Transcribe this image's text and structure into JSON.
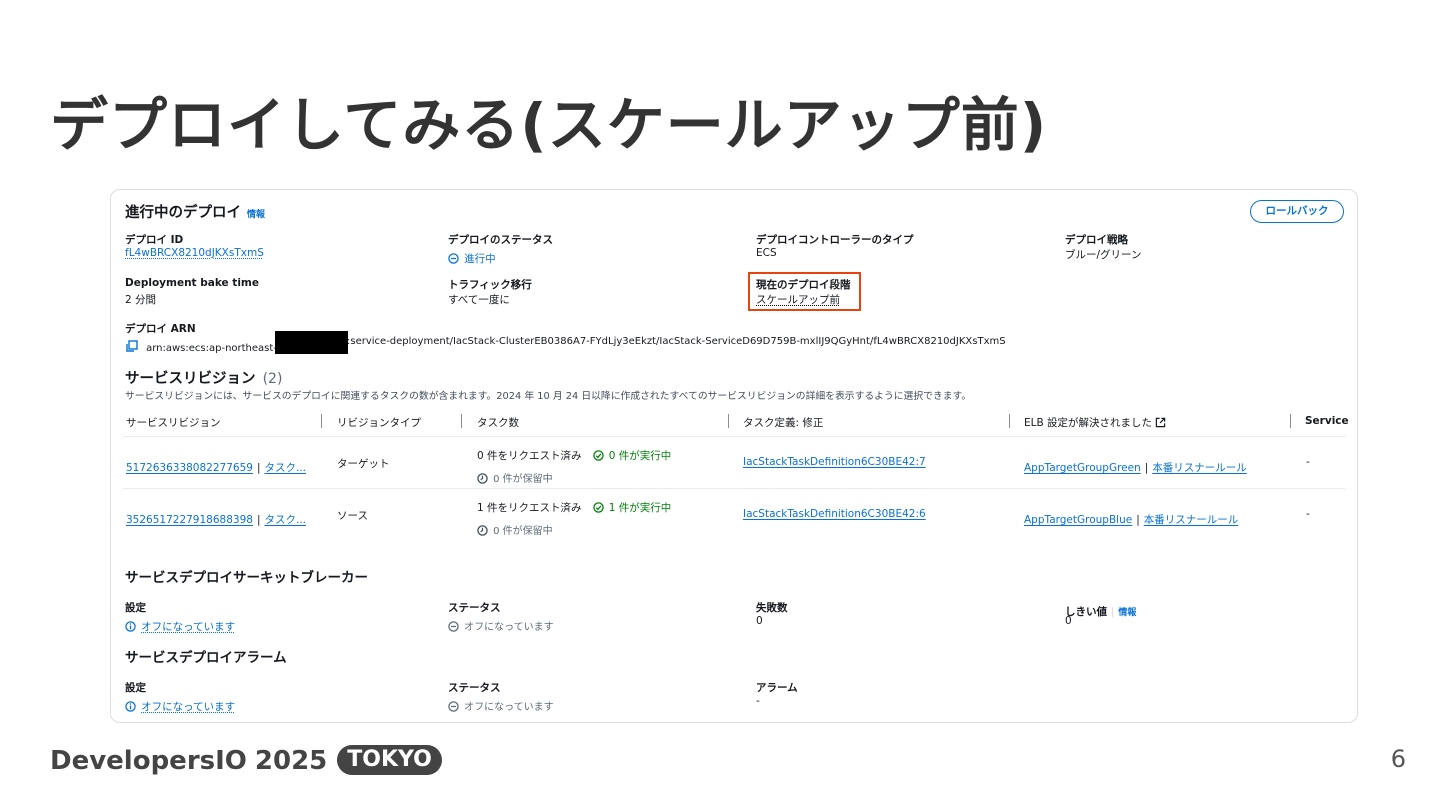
{
  "slide": {
    "title": "デプロイしてみる(スケールアップ前)",
    "footer_brand": "DevelopersIO",
    "footer_year": "2025",
    "footer_tag": "TOKYO",
    "page_number": "6"
  },
  "deploy": {
    "heading": "進行中のデプロイ",
    "info": "情報",
    "rollback_label": "ロールバック",
    "id_label": "デプロイ ID",
    "id_value": "fL4wBRCX8210dJKXsTxmS",
    "status_label": "デプロイのステータス",
    "status_value": "進行中",
    "controller_label": "デプロイコントローラーのタイプ",
    "controller_value": "ECS",
    "strategy_label": "デプロイ戦略",
    "strategy_value": "ブルー/グリーン",
    "bake_label": "Deployment bake time",
    "bake_value": "2 分間",
    "traffic_label": "トラフィック移行",
    "traffic_value": "すべて一度に",
    "phase_label": "現在のデプロイ段階",
    "phase_value": "スケールアップ前",
    "arn_label": "デプロイ ARN",
    "arn_prefix": "arn:aws:ecs:ap-northeast-1:",
    "arn_suffix": ":service-deployment/IacStack-ClusterEB0386A7-FYdLjy3eEkzt/IacStack-ServiceD69D759B-mxlIJ9QGyHnt/fL4wBRCX8210dJKXsTxmS"
  },
  "revisions": {
    "heading": "サービスリビジョン",
    "count": "(2)",
    "description": "サービスリビジョンには、サービスのデプロイに関連するタスクの数が含まれます。2024 年 10 月 24 日以降に作成されたすべてのサービスリビジョンの詳細を表示するように選択できます。",
    "columns": [
      "サービスリビジョン",
      "リビジョンタイプ",
      "タスク数",
      "タスク定義: 修正",
      "ELB 設定が解決されました",
      "Service"
    ],
    "rows": [
      {
        "revision": "5172636338082277659",
        "task_link": "タスク...",
        "type": "ターゲット",
        "requested": "0 件をリクエスト済み",
        "running": "0 件が実行中",
        "pending": "0 件が保留中",
        "task_def": "IacStackTaskDefinition6C30BE42:7",
        "target_group": "AppTargetGroupGreen",
        "listener_rule": "本番リスナールール",
        "service": "-"
      },
      {
        "revision": "3526517227918688398",
        "task_link": "タスク...",
        "type": "ソース",
        "requested": "1 件をリクエスト済み",
        "running": "1 件が実行中",
        "pending": "0 件が保留中",
        "task_def": "IacStackTaskDefinition6C30BE42:6",
        "target_group": "AppTargetGroupBlue",
        "listener_rule": "本番リスナールール",
        "service": "-"
      }
    ]
  },
  "breaker": {
    "heading": "サービスデプロイサーキットブレーカー",
    "setting_label": "設定",
    "setting_value": "オフになっています",
    "status_label": "ステータス",
    "status_value": "オフになっています",
    "failures_label": "失敗数",
    "failures_value": "0",
    "threshold_label": "しきい値",
    "threshold_info": "情報",
    "threshold_value": "0"
  },
  "alarm": {
    "heading": "サービスデプロイアラーム",
    "setting_label": "設定",
    "setting_value": "オフになっています",
    "status_label": "ステータス",
    "status_value": "オフになっています",
    "alarm_label": "アラーム",
    "alarm_value": "-"
  }
}
